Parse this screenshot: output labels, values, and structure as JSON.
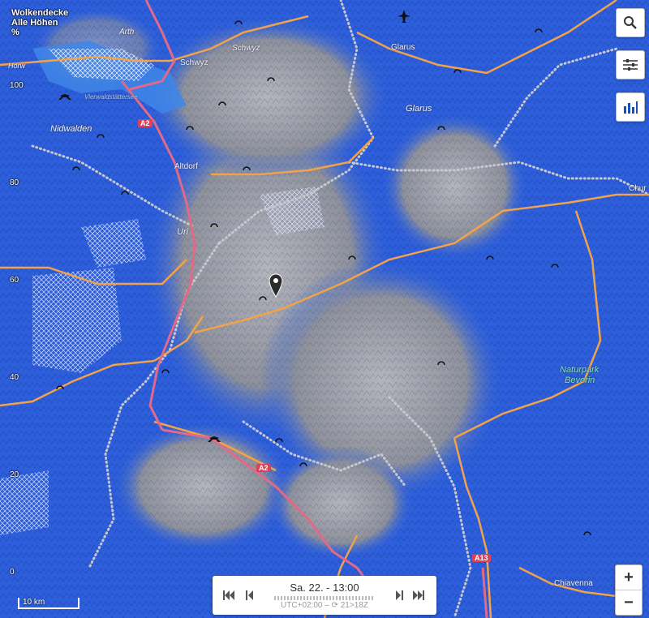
{
  "legend": {
    "line1": "Wolkendecke",
    "line2": "Alle Höhen",
    "unit": "%"
  },
  "scale_ticks": [
    "100",
    "80",
    "60",
    "40",
    "20",
    "0"
  ],
  "places": {
    "arth": "Arth",
    "schwyz_town": "Schwyz",
    "schwyz_region": "Schwyz",
    "glarus_town": "Glarus",
    "glarus_region": "Glarus",
    "vierwaldstaettersee": "Vierwaldstättersee",
    "nidwalden": "Nidwalden",
    "altdorf": "Altdorf",
    "uri": "Uri",
    "chiavenna": "Chiavenna",
    "naturpark_line1": "Naturpark",
    "naturpark_line2": "Beverin",
    "horw": "Horw",
    "chur_edge": "Chur"
  },
  "roads": {
    "a2_north": "A2",
    "a2_south": "A2",
    "a13": "A13"
  },
  "scalebar": {
    "label": "10 km"
  },
  "time_panel": {
    "title": "Sa. 22. - 13:00",
    "subtitle": "UTC+02:00 – ⟳ 21>18Z"
  },
  "controls": {
    "zoom_in": "+",
    "zoom_out": "−"
  },
  "icons": [
    "search-icon",
    "sliders-icon",
    "bar-chart-icon",
    "airport-icon",
    "location-pin-icon",
    "paragliding-icon"
  ],
  "colors": {
    "cloud_blue": "#2f63e0",
    "terrain_gray": "#9a9aa0",
    "road_orange": "#f2a24a",
    "motorway_pink": "#e06a88",
    "border_dots": "#c8c8d0"
  }
}
